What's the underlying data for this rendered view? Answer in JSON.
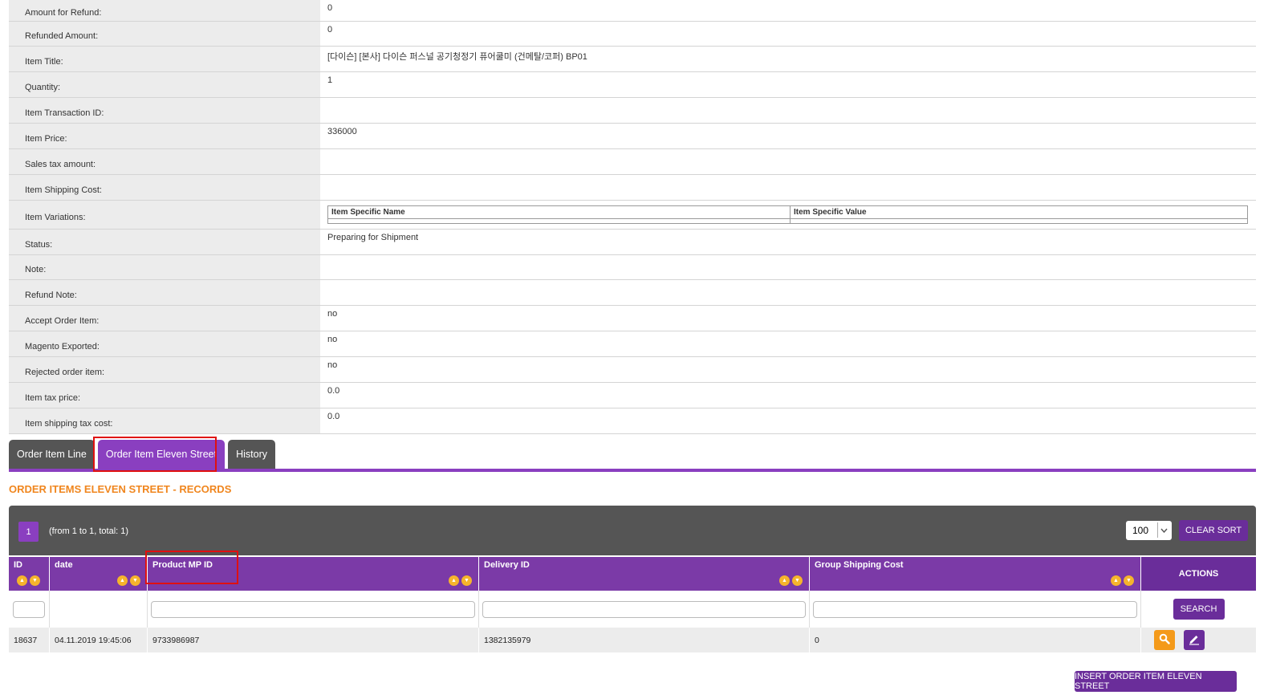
{
  "details": [
    {
      "label": "Amount for Refund:",
      "value": "0"
    },
    {
      "label": "Refunded Amount:",
      "value": "0"
    },
    {
      "label": "Item Title:",
      "value": "[다이슨] [본사] 다이슨 퍼스널 공기청정기 퓨어쿨미 (건메탈/코퍼) BP01"
    },
    {
      "label": "Quantity:",
      "value": "1"
    },
    {
      "label": "Item Transaction ID:",
      "value": ""
    },
    {
      "label": "Item Price:",
      "value": "336000"
    },
    {
      "label": "Sales tax amount:",
      "value": ""
    },
    {
      "label": "Item Shipping Cost:",
      "value": ""
    },
    {
      "label": "Item Variations:",
      "value": ""
    },
    {
      "label": "Status:",
      "value": "Preparing for Shipment"
    },
    {
      "label": "Note:",
      "value": ""
    },
    {
      "label": "Refund Note:",
      "value": ""
    },
    {
      "label": "Accept Order Item:",
      "value": "no"
    },
    {
      "label": "Magento Exported:",
      "value": "no"
    },
    {
      "label": "Rejected order item:",
      "value": "no"
    },
    {
      "label": "Item tax price:",
      "value": "0.0"
    },
    {
      "label": "Item shipping tax cost:",
      "value": "0.0"
    }
  ],
  "variations": {
    "col_name": "Item Specific Name",
    "col_value": "Item Specific Value"
  },
  "tabs": [
    {
      "label": "Order Item Line"
    },
    {
      "label": "Order Item Eleven Street"
    },
    {
      "label": "History"
    }
  ],
  "section_title": "ORDER ITEMS ELEVEN STREET - RECORDS",
  "pager": {
    "current_page": "1",
    "info": "(from 1 to 1, total: 1)",
    "per_page": "100",
    "clear_sort": "CLEAR SORT"
  },
  "columns": {
    "id": "ID",
    "date": "date",
    "product_mp_id": "Product MP ID",
    "delivery_id": "Delivery ID",
    "group_shipping_cost": "Group Shipping Cost",
    "actions": "ACTIONS"
  },
  "search_label": "SEARCH",
  "rows": [
    {
      "id": "18637",
      "date": "04.11.2019 19:45:06",
      "product_mp_id": "9733986987",
      "delivery_id": "1382135979",
      "group_shipping_cost": "0"
    }
  ],
  "insert_label": "INSERT ORDER ITEM ELEVEN STREET",
  "colors": {
    "accent": "#8a3fc0",
    "header_purple": "#7b3aa7",
    "button_purple": "#6a2d9a",
    "title_orange": "#f0861e",
    "view_orange": "#f49a1a",
    "highlight_red": "#e01010"
  }
}
